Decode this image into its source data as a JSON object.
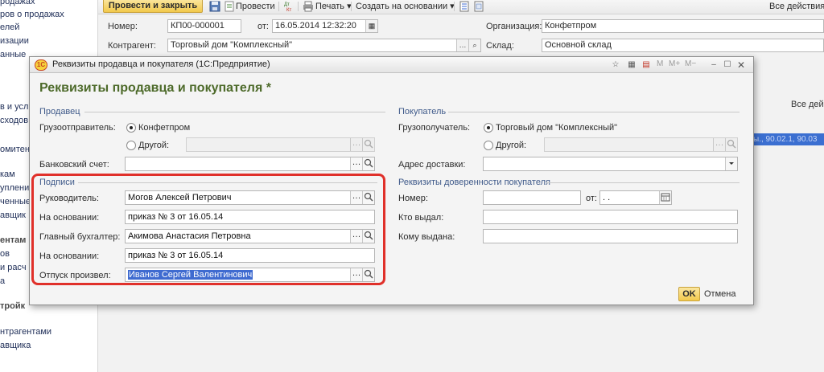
{
  "sidebar": {
    "items": [
      {
        "label": "родажах",
        "bold": false
      },
      {
        "label": "ров о продажах",
        "bold": false
      },
      {
        "label": "елей",
        "bold": false
      },
      {
        "label": "изации",
        "bold": false
      },
      {
        "label": "анные",
        "bold": false
      },
      {
        "label": "в и усл",
        "bold": false
      },
      {
        "label": "сходов",
        "bold": false
      },
      {
        "label": "омитен",
        "bold": false
      },
      {
        "label": "кам",
        "bold": false
      },
      {
        "label": "уплени",
        "bold": false
      },
      {
        "label": "ченные",
        "bold": false
      },
      {
        "label": "авщик",
        "bold": false
      },
      {
        "label": "ентам",
        "bold": true
      },
      {
        "label": "ов",
        "bold": false
      },
      {
        "label": "и расч",
        "bold": false
      },
      {
        "label": "а",
        "bold": false
      },
      {
        "label": "тройк",
        "bold": true
      },
      {
        "label": "нтрагентами",
        "bold": false
      },
      {
        "label": "авщика",
        "bold": false
      }
    ]
  },
  "toolbar": {
    "post_and_close": "Провести и закрыть",
    "post": "Провести",
    "print": "Печать",
    "create_based_on": "Создать на основании",
    "all_actions": "Все действия"
  },
  "document": {
    "number_label": "Номер:",
    "number_value": "КП00-000001",
    "date_label": "от:",
    "date_value": "16.05.2014 12:32:20",
    "organization_label": "Организация:",
    "organization_value": "Конфетпром",
    "counterparty_label": "Контрагент:",
    "counterparty_value": "Торговый дом \"Комплексный\"",
    "warehouse_label": "Склад:",
    "warehouse_value": "Основной склад",
    "all_actions_2": "Все дейс",
    "selected_cell": "ы., 90.02.1, 90.03"
  },
  "dialog": {
    "window_title": "Реквизиты продавца и покупателя  (1С:Предприятие)",
    "heading": "Реквизиты продавца и покупателя *",
    "titlebar_buttons": {
      "m": "M",
      "m_plus": "M+",
      "m_minus": "M−"
    },
    "seller": {
      "section": "Продавец",
      "shipper_label": "Грузоотправитель:",
      "shipper_option_1": "Конфетпром",
      "shipper_option_2": "Другой:",
      "bank_account_label": "Банковский счет:",
      "bank_account_value": ""
    },
    "buyer": {
      "section": "Покупатель",
      "consignee_label": "Грузополучатель:",
      "consignee_option_1": "Торговый дом \"Комплексный\"",
      "consignee_option_2": "Другой:",
      "delivery_address_label": "Адрес доставки:",
      "delivery_address_value": ""
    },
    "signatures": {
      "section": "Подписи",
      "director_label": "Руководитель:",
      "director_value": "Могов Алексей Петрович",
      "director_basis_label": "На основании:",
      "director_basis_value": "приказ № 3 от 16.05.14",
      "accountant_label": "Главный бухгалтер:",
      "accountant_value": "Акимова Анастасия Петровна",
      "accountant_basis_label": "На основании:",
      "accountant_basis_value": "приказ № 3 от 16.05.14",
      "released_by_label": "Отпуск произвел:",
      "released_by_value": "Иванов Сергей Валентинович"
    },
    "power_of_attorney": {
      "section": "Реквизиты доверенности покупателя",
      "number_label": "Номер:",
      "number_value": "",
      "date_label": "от:",
      "date_value": " .  .",
      "issued_by_label": "Кто выдал:",
      "issued_by_value": "",
      "issued_to_label": "Кому выдана:",
      "issued_to_value": ""
    },
    "ok": "OK",
    "cancel": "Отмена"
  },
  "colors": {
    "accent_yellow": "#f2c94c",
    "heading_green": "#4d6a2a",
    "section_blue": "#3f5a8a",
    "highlight_red": "#e0302a",
    "selection_blue": "#3f6bd0"
  }
}
